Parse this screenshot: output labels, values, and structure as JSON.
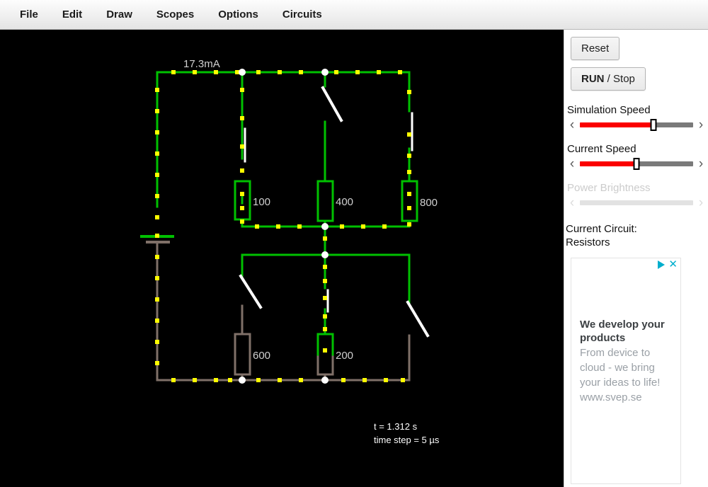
{
  "menu": {
    "items": [
      {
        "label": "File"
      },
      {
        "label": "Edit"
      },
      {
        "label": "Draw"
      },
      {
        "label": "Scopes"
      },
      {
        "label": "Options"
      },
      {
        "label": "Circuits"
      }
    ]
  },
  "canvas": {
    "background": "#000000",
    "wire_live_color": "#00c000",
    "wire_dead_color": "#7f7068",
    "current_dot_color": "#ffff00",
    "node_color": "#ffffff",
    "switch_color": "#ffffff",
    "label_color": "#d0d0d0",
    "current_label": "17.3mA",
    "time_label": "t = 1.312 s",
    "time_step_label": "time step = 5 µs",
    "resistors": [
      {
        "label": "100",
        "live": true
      },
      {
        "label": "400",
        "live": true
      },
      {
        "label": "800",
        "live": true
      },
      {
        "label": "600",
        "live": false
      },
      {
        "label": "200",
        "live": true
      }
    ]
  },
  "panel": {
    "reset_label": "Reset",
    "run_label": "RUN",
    "run_sep": " / ",
    "stop_label": "Stop",
    "sliders": [
      {
        "label": "Simulation Speed",
        "value": 65,
        "enabled": true
      },
      {
        "label": "Current Speed",
        "value": 50,
        "enabled": true
      },
      {
        "label": "Power Brightness",
        "value": 0,
        "enabled": false
      }
    ],
    "left_arrow": "‹",
    "right_arrow": "›",
    "current_circuit_title": "Current Circuit:",
    "current_circuit_name": "Resistors",
    "accent_color": "#fb0000"
  },
  "ad": {
    "title": "We develop your products",
    "text": "From device to cloud - we bring your ideas to life! www.svep.se",
    "close_glyph": "✕"
  }
}
